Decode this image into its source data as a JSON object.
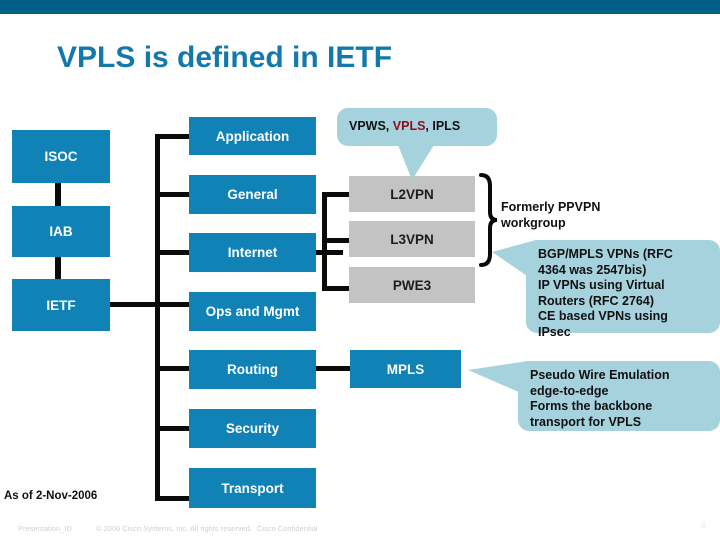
{
  "slide": {
    "title": "VPLS is defined in IETF",
    "as_of": "As of 2-Nov-2006",
    "page_number": "8"
  },
  "colors": {
    "topbar": "#015e86",
    "title": "#1379ab",
    "box_blue": "#1082b6",
    "box_gray": "#c3c3c3",
    "callout": "#a6d2de",
    "highlight": "#8e1020",
    "line": "#0a0a0a"
  },
  "org_column": {
    "items": [
      {
        "label": "ISOC"
      },
      {
        "label": "IAB"
      },
      {
        "label": "IETF"
      }
    ]
  },
  "area_column": {
    "items": [
      {
        "label": "Application"
      },
      {
        "label": "General"
      },
      {
        "label": "Internet"
      },
      {
        "label": "Ops and Mgmt"
      },
      {
        "label": "Routing"
      },
      {
        "label": "Security"
      },
      {
        "label": "Transport"
      }
    ]
  },
  "wg_column": {
    "items": [
      {
        "label": "L2VPN"
      },
      {
        "label": "L3VPN"
      },
      {
        "label": "PWE3"
      },
      {
        "label": "MPLS"
      }
    ]
  },
  "callouts": {
    "vpws": {
      "text_before": "VPWS, ",
      "highlight": "VPLS",
      "text_after": ", IPLS"
    },
    "ppvpn": {
      "line1": "Formerly PPVPN",
      "line2": "workgroup"
    },
    "l3vpn_detail": {
      "line1": "BGP/MPLS VPNs (RFC",
      "line2": "4364 was 2547bis)",
      "line3": "IP VPNs using Virtual",
      "line4": "Routers (RFC 2764)",
      "line5": "CE based VPNs using",
      "line6": "IPsec"
    },
    "pwe3_detail": {
      "line1": "Pseudo Wire Emulation",
      "line2": "edge-to-edge",
      "line3": "Forms the backbone",
      "line4": "transport for VPLS"
    }
  },
  "footer": {
    "presentation_id": "Presentation_ID",
    "copyright": "© 2006 Cisco Systems, Inc. All rights reserved.",
    "confidential": "Cisco Confidential"
  }
}
